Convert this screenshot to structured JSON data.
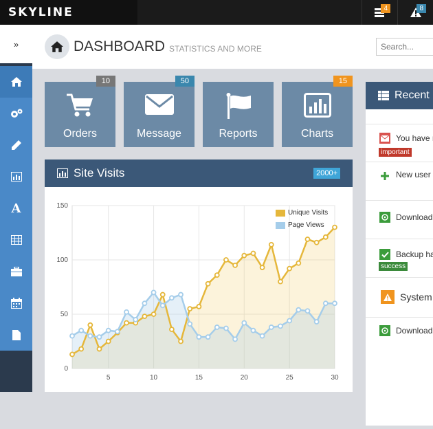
{
  "app": {
    "brand": "SKYLINE"
  },
  "topbar": {
    "notifications": [
      {
        "icon": "tasks-icon",
        "count": "4",
        "color": "#f0941e"
      },
      {
        "icon": "warning-icon",
        "count": "8",
        "color": "#3a87ad"
      }
    ]
  },
  "sidebar": {
    "toggle": "»",
    "items": [
      {
        "icon": "home-icon"
      },
      {
        "icon": "gears-icon"
      },
      {
        "icon": "pencil-icon"
      },
      {
        "icon": "bar-chart-icon"
      },
      {
        "icon": "font-icon",
        "glyph": "A"
      },
      {
        "icon": "table-icon"
      },
      {
        "icon": "briefcase-icon"
      },
      {
        "icon": "calendar-icon"
      },
      {
        "icon": "file-icon"
      }
    ]
  },
  "header": {
    "title": "DASHBOARD",
    "subtitle": "STATISTICS AND MORE",
    "search_placeholder": "Search..."
  },
  "tiles": [
    {
      "label": "Orders",
      "badge": "10",
      "badge_color": "#777777",
      "icon": "cart-icon"
    },
    {
      "label": "Message",
      "badge": "50",
      "badge_color": "#3a87ad",
      "icon": "envelope-icon"
    },
    {
      "label": "Reports",
      "badge": "",
      "badge_color": "",
      "icon": "flag-icon"
    },
    {
      "label": "Charts",
      "badge": "15",
      "badge_color": "#f0941e",
      "icon": "chart-icon"
    }
  ],
  "site_visits": {
    "title": "Site Visits",
    "badge": "2000+"
  },
  "chart_data": {
    "type": "line",
    "x": [
      1,
      2,
      3,
      4,
      5,
      6,
      7,
      8,
      9,
      10,
      11,
      12,
      13,
      14,
      15,
      16,
      17,
      18,
      19,
      20,
      21,
      22,
      23,
      24,
      25,
      26,
      27,
      28,
      29,
      30
    ],
    "series": [
      {
        "name": "Unique Visits",
        "color": "#e5b73b",
        "values": [
          13,
          18,
          40,
          18,
          25,
          33,
          42,
          42,
          48,
          50,
          68,
          36,
          25,
          55,
          57,
          78,
          86,
          100,
          95,
          104,
          106,
          93,
          114,
          80,
          92,
          97,
          119,
          116,
          121,
          130
        ]
      },
      {
        "name": "Page Views",
        "color": "#a5cdea",
        "values": [
          30,
          35,
          30,
          29,
          35,
          34,
          52,
          45,
          60,
          70,
          58,
          65,
          68,
          41,
          29,
          29,
          38,
          37,
          27,
          42,
          35,
          30,
          38,
          39,
          44,
          54,
          53,
          43,
          60,
          60
        ]
      }
    ],
    "xticks": [
      "5",
      "10",
      "15",
      "20",
      "25",
      "30"
    ],
    "yticks": [
      "0",
      "50",
      "100",
      "150"
    ],
    "ylim": [
      0,
      150
    ],
    "xlim": [
      1,
      30
    ],
    "grid": true,
    "legend": "top-right"
  },
  "recent": {
    "title": "Recent",
    "items": [
      {
        "icon": "envelope-icon",
        "icon_color": "#d9534f",
        "text": "You have r",
        "tag": "important",
        "tag_color": "#c0392b"
      },
      {
        "icon": "plus-icon",
        "icon_color": "#3b9c3b",
        "text": "New user",
        "tag": "",
        "tag_color": ""
      },
      {
        "icon": "download-icon",
        "icon_color": "#3b9c3b",
        "text": "Download",
        "tag": "",
        "tag_color": ""
      },
      {
        "icon": "check-icon",
        "icon_color": "#3b9c3b",
        "text": "Backup ha",
        "tag": "success",
        "tag_color": "#3b8a3b"
      },
      {
        "icon": "warning-icon",
        "icon_color": "#f0941e",
        "text": "System",
        "tag": "",
        "tag_color": ""
      },
      {
        "icon": "download-icon",
        "icon_color": "#3b9c3b",
        "text": "Download",
        "tag": "",
        "tag_color": ""
      }
    ]
  }
}
